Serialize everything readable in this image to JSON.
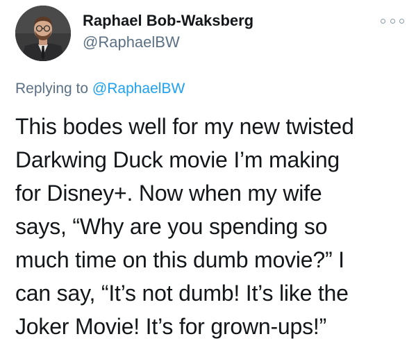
{
  "tweet": {
    "author": {
      "display_name": "Raphael Bob-Waksberg",
      "handle": "@RaphaelBW",
      "avatar_icon": "profile-photo"
    },
    "more_icon": "more-options-icon",
    "replying_prefix": "Replying to ",
    "replying_to": "@RaphaelBW",
    "text": "This bodes well for my new twisted\nDarkwing Duck movie I’m making\nfor Disney+. Now when my wife\nsays, “Why are you spending so\nmuch time on this dumb movie?” I\ncan say, “It’s not dumb! It’s like the\nJoker Movie! It’s for grown-ups!”"
  },
  "colors": {
    "text_primary": "#14171a",
    "text_secondary": "#5b7083",
    "link": "#1da1f2"
  }
}
